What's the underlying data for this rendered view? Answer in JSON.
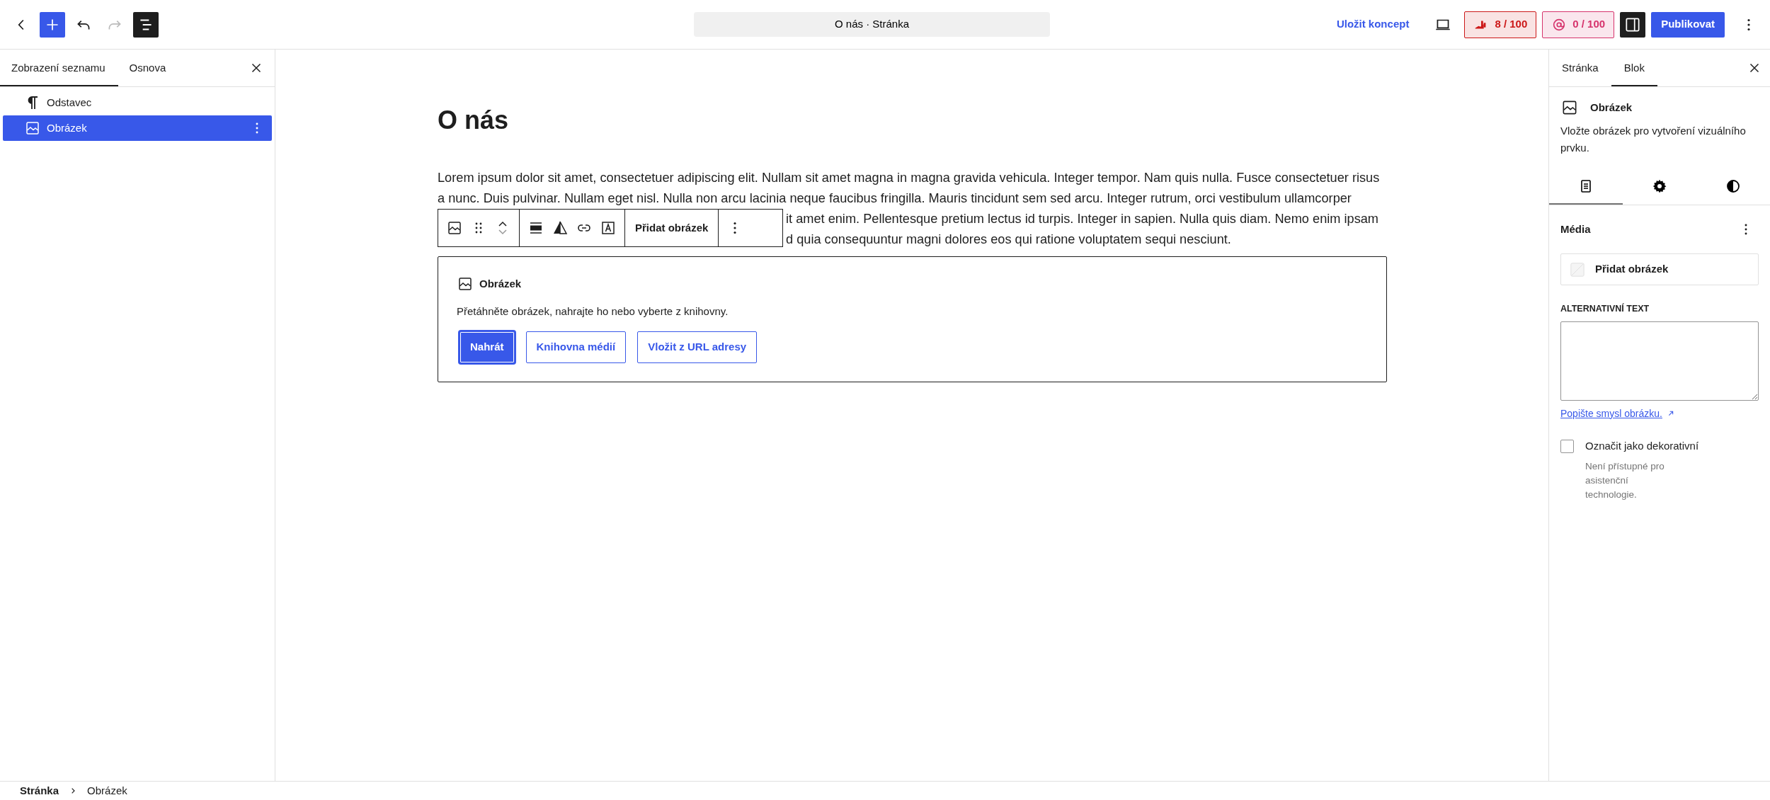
{
  "top_bar": {
    "tools": [
      {
        "kind": "back",
        "disabled": false,
        "pressed": false
      },
      {
        "kind": "inserter",
        "disabled": false,
        "pressed": true
      },
      {
        "kind": "undo",
        "disabled": false,
        "pressed": false
      },
      {
        "kind": "redo",
        "disabled": true,
        "pressed": false
      },
      {
        "kind": "list_view",
        "disabled": false,
        "pressed": true
      }
    ],
    "document_title": "O nás · Stránka",
    "save_draft": "Uložit koncept",
    "scores": [
      {
        "kind": "readability",
        "text": "8 / 100",
        "color": "#cc1818"
      },
      {
        "kind": "seo",
        "text": "0 / 100",
        "color": "#d6336c"
      }
    ],
    "settings_toggle_pressed": true,
    "publish": "Publikovat"
  },
  "left_panel": {
    "tabs": [
      {
        "label": "Zobrazení seznamu",
        "selected": true
      },
      {
        "label": "Osnova",
        "selected": false
      }
    ],
    "blocks": [
      {
        "kind": "paragraph",
        "label": "Odstavec",
        "selected": false
      },
      {
        "kind": "image",
        "label": "Obrázek",
        "selected": true
      }
    ]
  },
  "editor": {
    "heading": "O nás",
    "paragraph_lines": [
      "Lorem ipsum dolor sit amet, consectetuer adipiscing elit. Nullam sit amet magna in magna gravida vehicula. Integer tempor. Nam quis nulla. Fusce consectetuer risus",
      "a nunc. Duis pulvinar. Nullam eget nisl. Nulla non arcu lacinia neque faucibus fringilla. Mauris tincidunt sem sed arcu. Integer rutrum, orci vestibulum ullamcorper"
    ],
    "lines_beside_toolbar": [
      "it amet enim. Pellentesque pretium lectus id turpis. Integer in sapien. Nulla quis diam. Nemo enim ipsam",
      "d quia consequuntur magni dolores eos qui ratione voluptatem sequi nesciunt."
    ],
    "block_toolbar": {
      "add_image": "Přidat obrázek"
    },
    "image_placeholder": {
      "title": "Obrázek",
      "instructions": "Přetáhněte obrázek, nahrajte ho nebo vyberte z knihovny.",
      "buttons": [
        {
          "label": "Nahrát",
          "primary": true
        },
        {
          "label": "Knihovna médií",
          "primary": false
        },
        {
          "label": "Vložit z URL adresy",
          "primary": false
        }
      ]
    }
  },
  "right_panel": {
    "tabs": [
      {
        "label": "Stránka",
        "selected": false
      },
      {
        "label": "Blok",
        "selected": true
      }
    ],
    "block_title": "Obrázek",
    "block_description": "Vložte obrázek pro vytvoření vizuálního prvku.",
    "inspector_tabs": [
      {
        "kind": "settings",
        "selected": true
      },
      {
        "kind": "advanced",
        "selected": false
      },
      {
        "kind": "styles",
        "selected": false
      }
    ],
    "media_heading": "Média",
    "add_image": "Přidat obrázek",
    "alt_label": "ALTERNATIVNÍ TEXT",
    "alt_help_link": "Popište smysl obrázku.",
    "decorative": {
      "label": "Označit jako dekorativní",
      "checked": false,
      "help": "Není přístupné pro asistenční technologie."
    }
  },
  "breadcrumb": [
    "Stránka",
    "Obrázek"
  ]
}
